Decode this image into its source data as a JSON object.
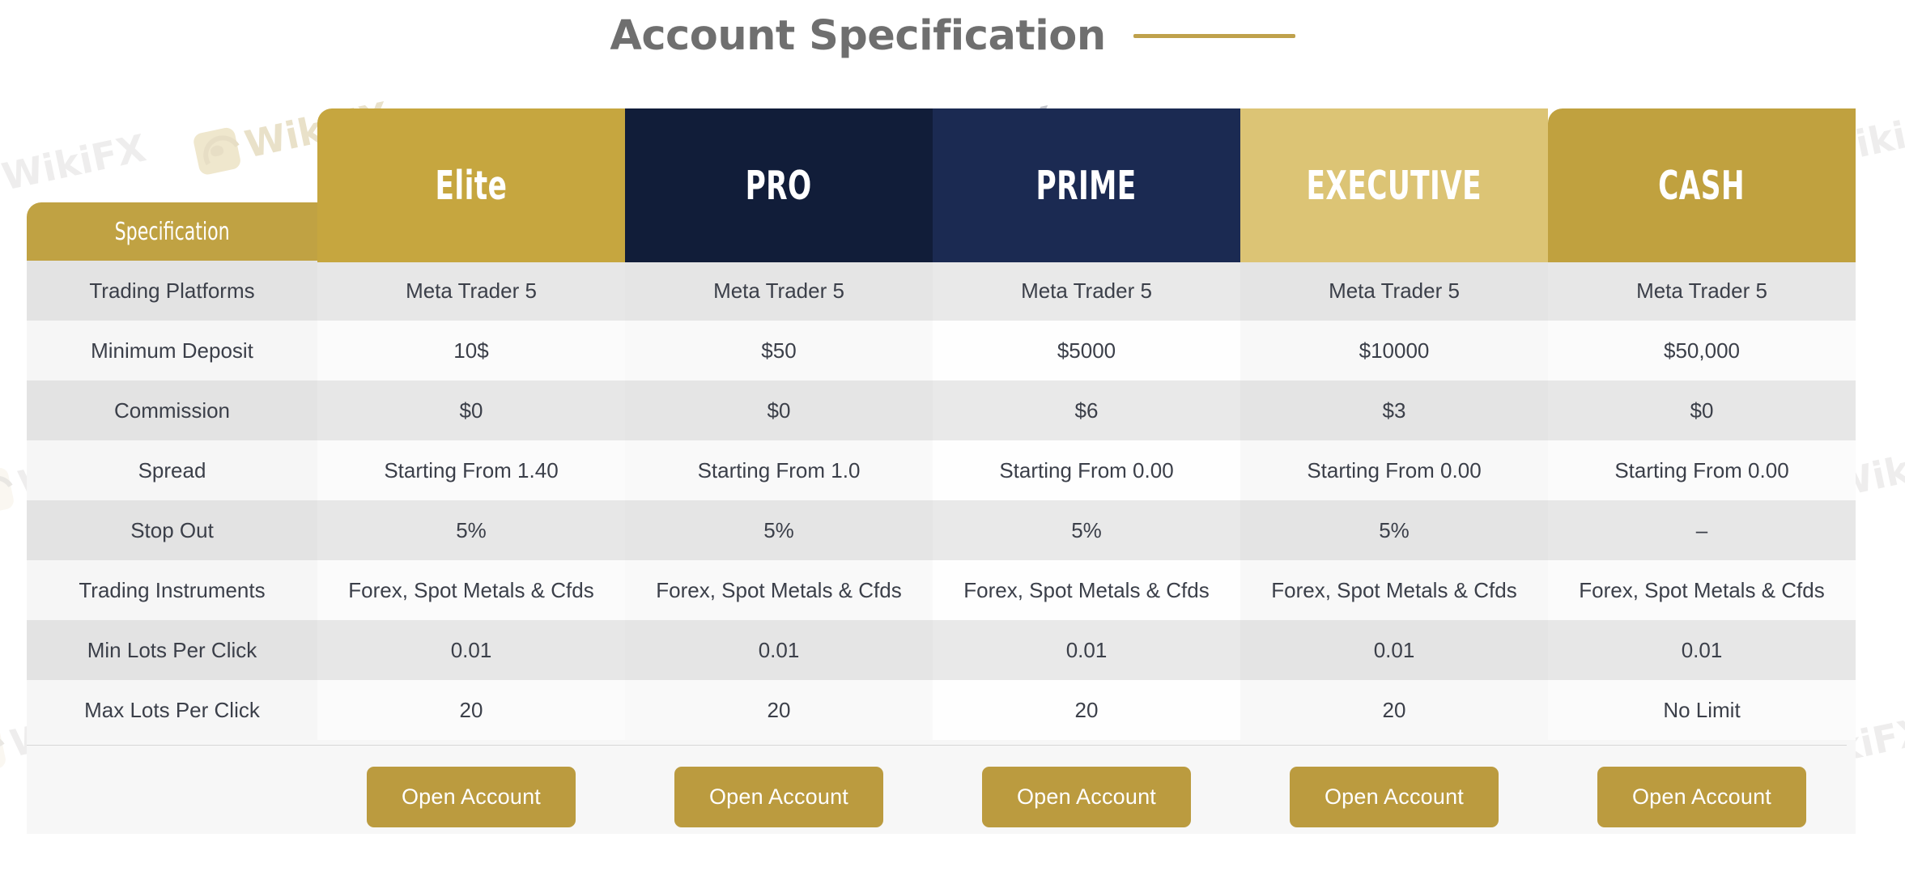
{
  "header": {
    "title": "Account Specification",
    "accent_color": "#bfa14c"
  },
  "table": {
    "spec_header": "Specification",
    "columns": [
      {
        "label": "Elite",
        "bg": "#c6a63f",
        "text": "#ffffff"
      },
      {
        "label": "PRO",
        "bg": "#111d39",
        "text": "#ffffff"
      },
      {
        "label": "PRIME",
        "bg": "#1b2a52",
        "text": "#ffffff"
      },
      {
        "label": "EXECUTIVE",
        "bg": "#dcc475",
        "text": "#ffffff"
      },
      {
        "label": "CASH",
        "bg": "#c0a13f",
        "text": "#ffffff"
      }
    ],
    "rows": [
      {
        "spec": "Trading Platforms",
        "values": [
          "Meta Trader 5",
          "Meta Trader 5",
          "Meta Trader 5",
          "Meta Trader 5",
          "Meta Trader 5"
        ]
      },
      {
        "spec": "Minimum Deposit",
        "values": [
          "10$",
          "$50",
          "$5000",
          "$10000",
          "$50,000"
        ]
      },
      {
        "spec": "Commission",
        "values": [
          "$0",
          "$0",
          "$6",
          "$3",
          "$0"
        ]
      },
      {
        "spec": "Spread",
        "values": [
          "Starting From 1.40",
          "Starting From 1.0",
          "Starting From 0.00",
          "Starting From 0.00",
          "Starting From 0.00"
        ]
      },
      {
        "spec": "Stop Out",
        "values": [
          "5%",
          "5%",
          "5%",
          "5%",
          "–"
        ]
      },
      {
        "spec": "Trading Instruments",
        "values": [
          "Forex, Spot Metals & Cfds",
          "Forex, Spot Metals & Cfds",
          "Forex, Spot Metals & Cfds",
          "Forex, Spot Metals & Cfds",
          "Forex, Spot Metals & Cfds"
        ]
      },
      {
        "spec": "Min Lots Per Click",
        "values": [
          "0.01",
          "0.01",
          "0.01",
          "0.01",
          "0.01"
        ]
      },
      {
        "spec": "Max Lots Per Click",
        "values": [
          "20",
          "20",
          "20",
          "20",
          "No Limit"
        ]
      }
    ]
  },
  "cta": {
    "label": "Open Account",
    "color": "#bb9b3f",
    "buttons": [
      "Open Account",
      "Open Account",
      "Open Account",
      "Open Account",
      "Open Account"
    ]
  },
  "watermark": {
    "text": "WikiFX",
    "icon": "wikifx-lion-icon"
  }
}
